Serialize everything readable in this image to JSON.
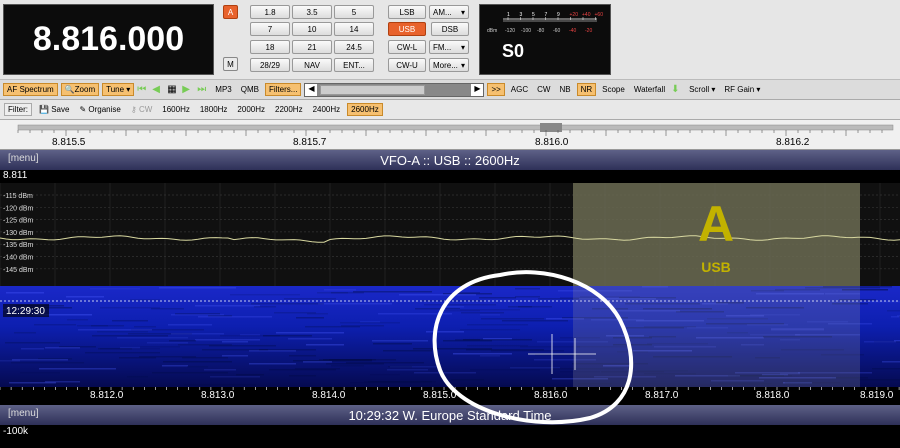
{
  "display": {
    "frequency": "8.816.000"
  },
  "controls": {
    "vfo_a": "A",
    "mem": "M"
  },
  "bands": [
    "1.8",
    "3.5",
    "5",
    "7",
    "10",
    "14",
    "18",
    "21",
    "24.5",
    "28/29",
    "NAV",
    "ENT..."
  ],
  "modes": {
    "lsb": "LSB",
    "am": "AM...",
    "usb": "USB",
    "dsb": "DSB",
    "cwl": "CW-L",
    "fm": "FM...",
    "cwu": "CW-U",
    "more": "More..."
  },
  "smeter": {
    "reading": "S0",
    "scale_top": [
      "1",
      "3",
      "5",
      "7",
      "9",
      "+20",
      "+40",
      "+60"
    ],
    "scale_bottom": [
      "-120",
      "-100",
      "-80",
      "-60",
      "-40",
      "-20"
    ],
    "unit": "dBm"
  },
  "toolbar": {
    "af_spectrum": "AF Spectrum",
    "zoom": "Zoom",
    "tune": "Tune",
    "mp3": "MP3",
    "qmb": "QMB",
    "filters": "Filters...",
    "expand": ">>",
    "agc": "AGC",
    "cw": "CW",
    "nb": "NB",
    "nr": "NR",
    "scope": "Scope",
    "waterfall": "Waterfall",
    "scroll": "Scroll",
    "rf_gain": "RF Gain"
  },
  "filterbar": {
    "label": "Filter:",
    "save": "Save",
    "organise": "Organise",
    "cw": "CW",
    "filters": [
      "1600Hz",
      "1800Hz",
      "2000Hz",
      "2200Hz",
      "2400Hz",
      "2600Hz"
    ],
    "active": "2600Hz"
  },
  "ruler": {
    "labels": [
      "8.815.5",
      "8.815.7",
      "8.816.0",
      "8.816.2"
    ]
  },
  "vfo_header": {
    "menu": "[menu]",
    "title": "VFO-A  ::  USB  ::  2600Hz"
  },
  "freq_bar": "8.811",
  "spectrum": {
    "levels": [
      "-115 dBm",
      "-120 dBm",
      "-125 dBm",
      "-130 dBm",
      "-135 dBm",
      "-140 dBm",
      "-145 dBm"
    ],
    "vfo_letter": "A",
    "vfo_mode": "USB"
  },
  "waterfall": {
    "time": "12:29:30"
  },
  "bottom_scale": {
    "labels": [
      "8.812.0",
      "8.813.0",
      "8.814.0",
      "8.815.0",
      "8.816.0",
      "8.817.0",
      "8.818.0",
      "8.819.0"
    ]
  },
  "status_header": {
    "menu": "[menu]",
    "text": "10:29:32 W. Europe Standard Time"
  },
  "offset": "-100k",
  "colors": {
    "display_bg": "#0c0c0c",
    "accent": "#e8622c",
    "passband": "#6b6b52",
    "trace": "#d8d8a0",
    "waterfall": "#0d1fb0"
  }
}
